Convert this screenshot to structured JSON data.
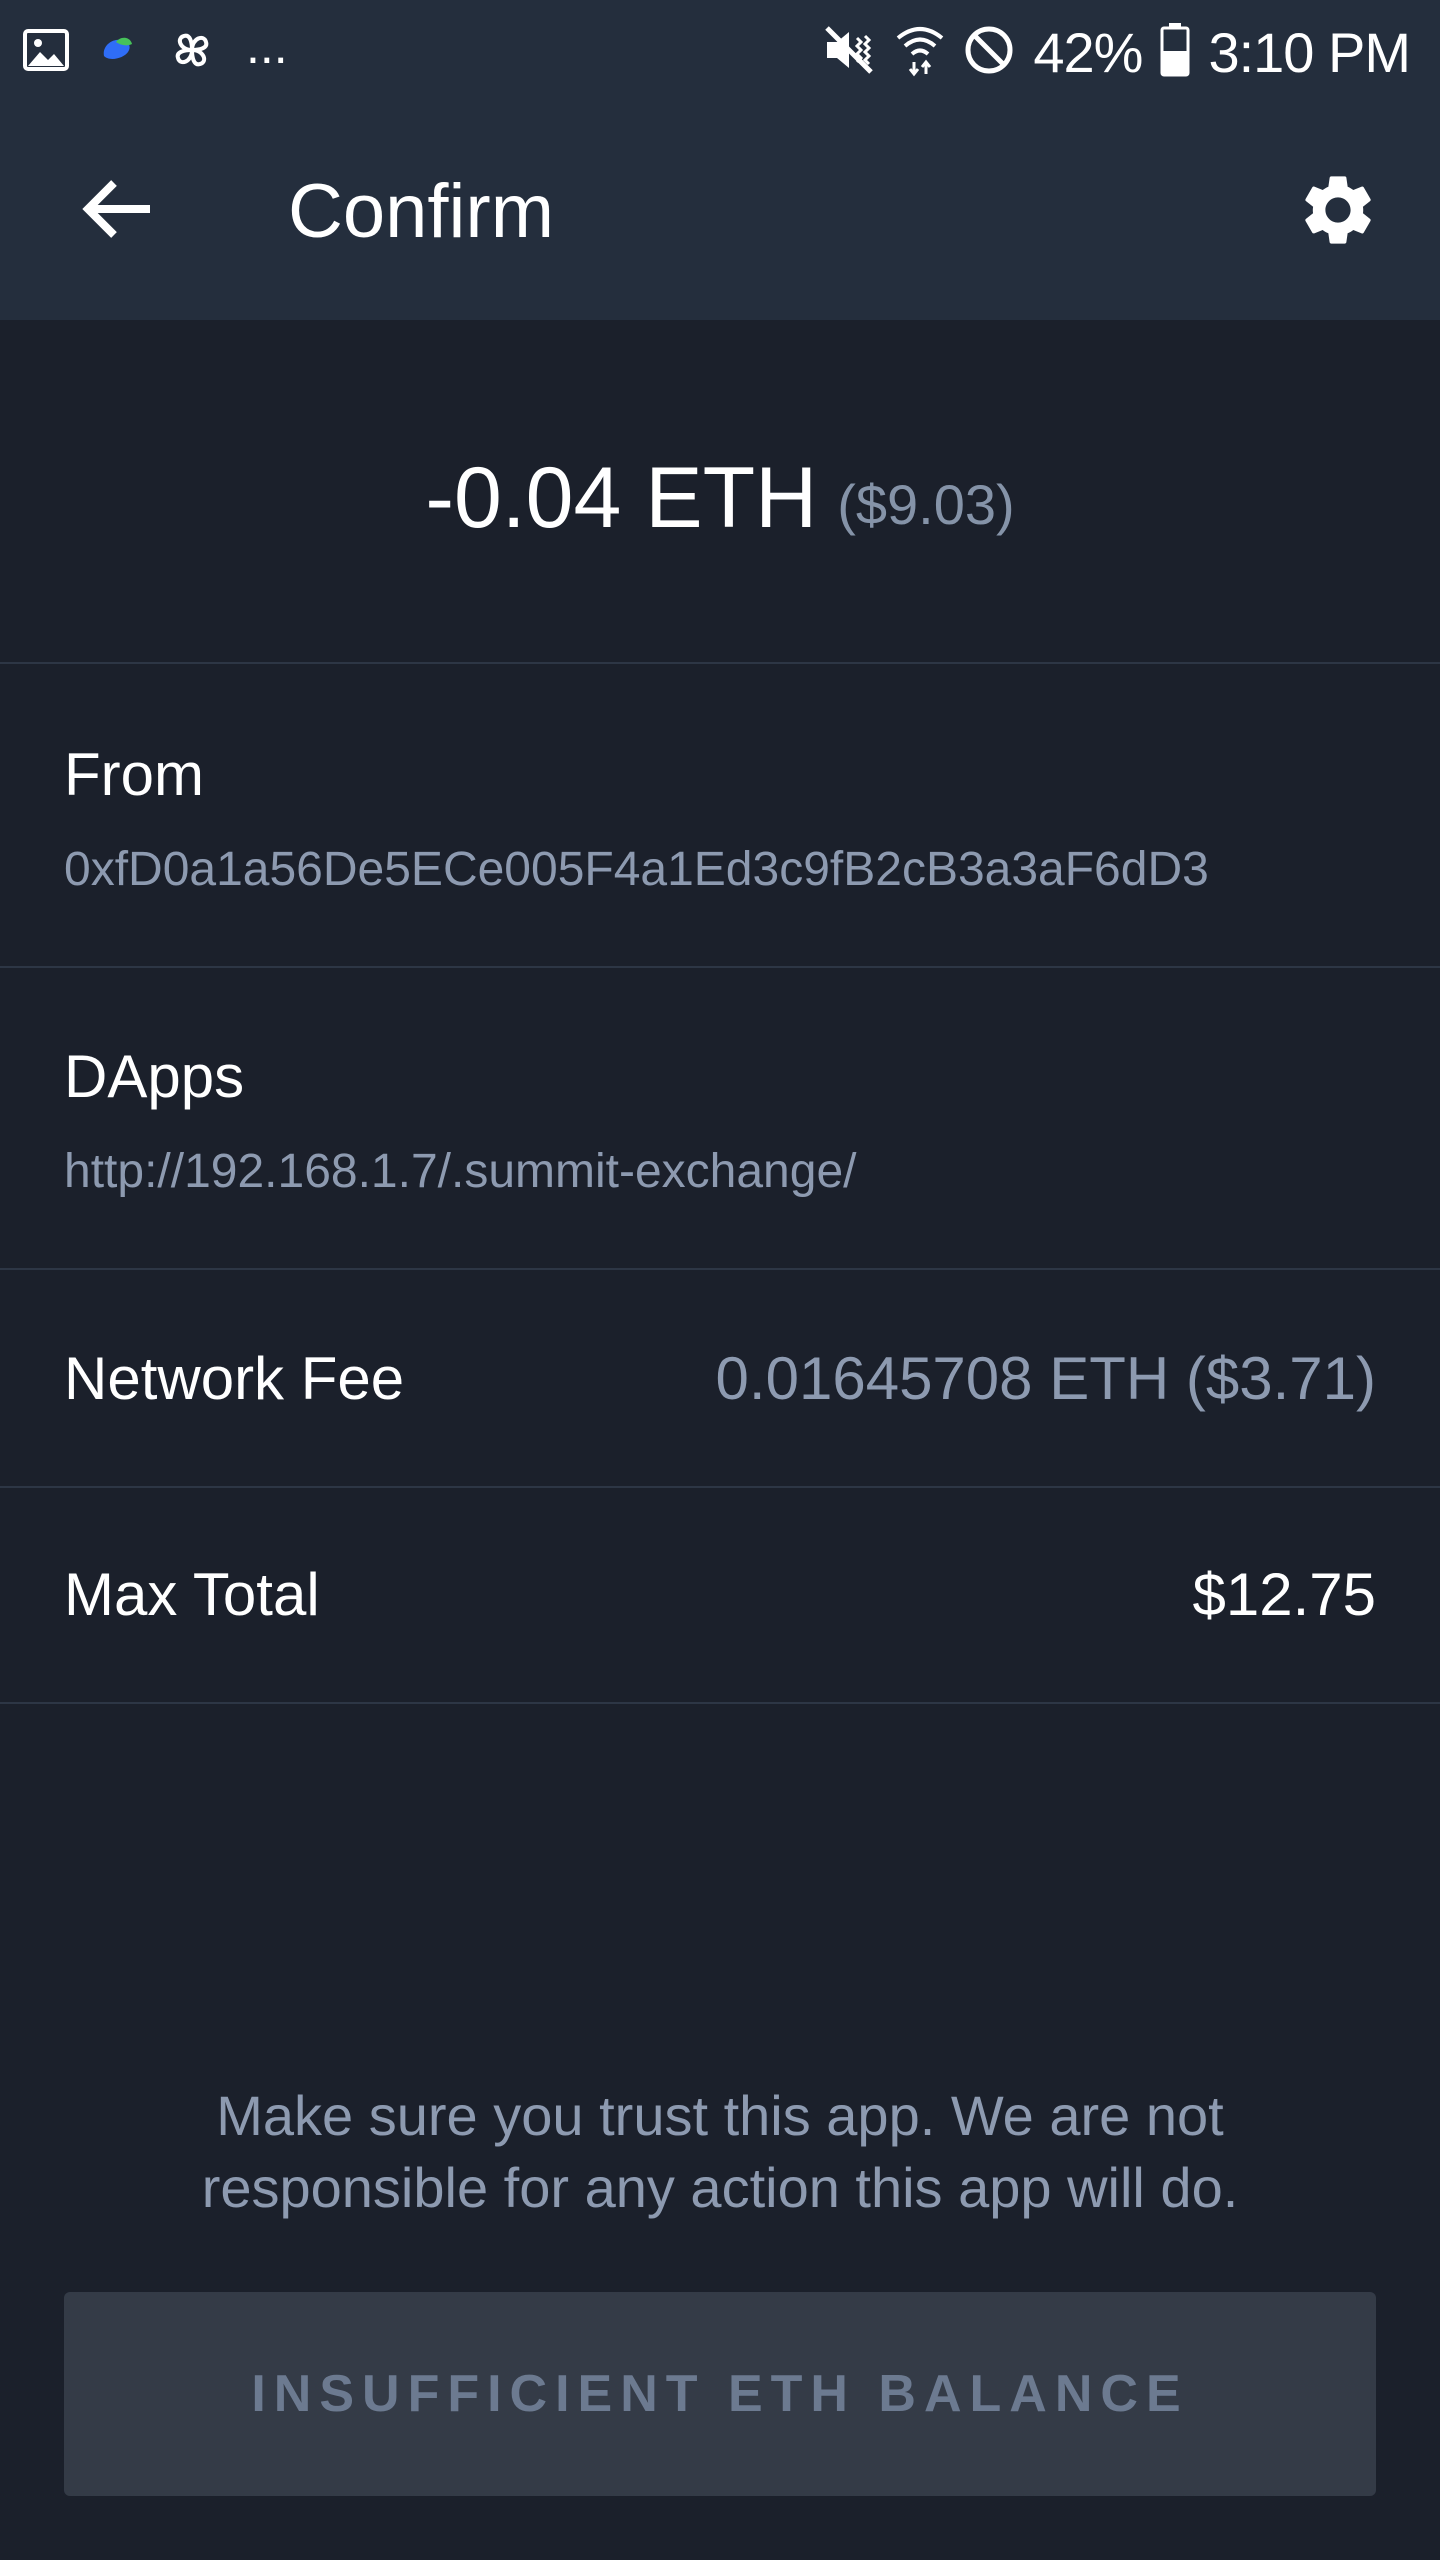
{
  "status_bar": {
    "battery": "42%",
    "time": "3:10 PM",
    "more": "...",
    "left_icons": [
      "gallery-icon",
      "app-blob-icon",
      "pinwheel-icon"
    ],
    "right_icons": [
      "mute-vibrate-icon",
      "wifi-icon",
      "do-not-disturb-icon",
      "battery-icon"
    ]
  },
  "app_bar": {
    "title": "Confirm",
    "back_icon": "arrow-left-icon",
    "settings_icon": "gear-icon"
  },
  "transaction": {
    "amount": "-0.04 ETH",
    "amount_fiat": "($9.03)"
  },
  "details": {
    "from_label": "From",
    "from_value": "0xfD0a1a56De5ECe005F4a1Ed3c9fB2cB3a3aF6dD3",
    "dapps_label": "DApps",
    "dapps_value": "http://192.168.1.7/.summit-exchange/",
    "fee_label": "Network Fee",
    "fee_value": "0.01645708 ETH ($3.71)",
    "total_label": "Max Total",
    "total_value": "$12.75"
  },
  "warning": {
    "line1": "Make sure you trust this app. We are not",
    "line2": "responsible for any action this app will do."
  },
  "action_button": {
    "label": "INSUFFICIENT ETH BALANCE"
  },
  "colors": {
    "background": "#1b202b",
    "header": "#242e3d",
    "divider": "#2d3645",
    "muted_text": "#8d9ab0",
    "button_bg": "#343b47",
    "button_text": "#6c7a90"
  }
}
